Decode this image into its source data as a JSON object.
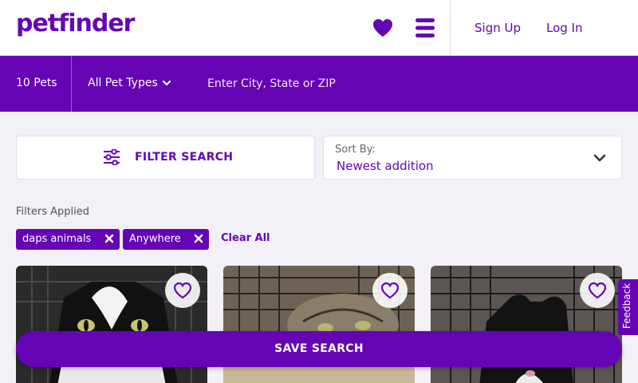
{
  "header": {
    "logo_text": "petfinder",
    "favorites_icon": "heart-icon",
    "menu_icon": "menu-icon",
    "signup_label": "Sign Up",
    "login_label": "Log In"
  },
  "search_bar": {
    "pet_count": "10 Pets",
    "pet_type_label": "All Pet Types",
    "location_placeholder": "Enter City, State or ZIP"
  },
  "filter": {
    "label": "FILTER SEARCH",
    "icon": "sliders-icon"
  },
  "sort": {
    "label": "Sort By:",
    "value": "Newest addition"
  },
  "filters_applied": {
    "heading": "Filters Applied",
    "chips": [
      "daps animals",
      "Anywhere"
    ],
    "clear_label": "Clear All"
  },
  "cards": [
    {
      "photo": "black-and-white-cat"
    },
    {
      "photo": "tabby-cat-in-crate"
    },
    {
      "photo": "black-and-white-cat-in-crate"
    }
  ],
  "feedback_label": "Feedback",
  "save_search_label": "SAVE SEARCH",
  "colors": {
    "brand_purple": "#6504b5",
    "page_background": "#f4f0f8"
  }
}
